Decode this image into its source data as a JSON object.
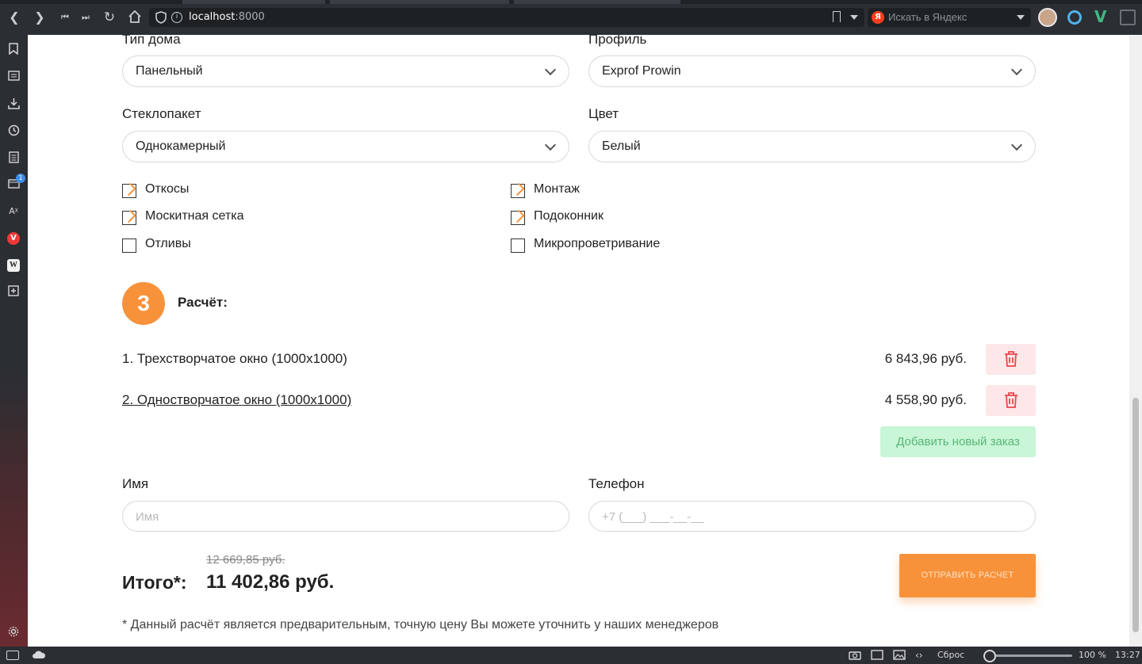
{
  "browser": {
    "url_host": "localhost",
    "url_port": ":8000",
    "search_placeholder": "Искать в Яндекс",
    "search_engine_icon": "Я",
    "sidebar_badge": "1",
    "status_reset": "Сброс",
    "status_zoom": "100 %",
    "status_time": "13:27"
  },
  "form": {
    "house_type": {
      "label": "Тип дома",
      "value": "Панельный"
    },
    "profile": {
      "label": "Профиль",
      "value": "Exprof Prowin"
    },
    "glass": {
      "label": "Стеклопакет",
      "value": "Однокамерный"
    },
    "color": {
      "label": "Цвет",
      "value": "Белый"
    },
    "options": [
      {
        "label": "Откосы",
        "checked": true
      },
      {
        "label": "Монтаж",
        "checked": true
      },
      {
        "label": "Москитная сетка",
        "checked": true
      },
      {
        "label": "Подоконник",
        "checked": true
      },
      {
        "label": "Отливы",
        "checked": false
      },
      {
        "label": "Микропроветривание",
        "checked": false
      }
    ]
  },
  "calc": {
    "step": "3",
    "title": "Расчёт:",
    "orders": [
      {
        "name": "1. Трехстворчатое окно (1000x1000)",
        "price": "6 843,96 руб."
      },
      {
        "name": "2. Одностворчатое окно (1000x1000)",
        "price": "4 558,90 руб."
      }
    ],
    "add_button": "Добавить новый заказ"
  },
  "contact": {
    "name_label": "Имя",
    "name_placeholder": "Имя",
    "phone_label": "Телефон",
    "phone_placeholder": "+7 (___) ___-__-__"
  },
  "total": {
    "label": "Итого*:",
    "old_value": "12 669,85 руб.",
    "value": "11 402,86 руб.",
    "send_button": "ОТПРАВИТЬ РАСЧЕТ",
    "footnote": "* Данный расчёт является предварительным, точную цену Вы можете уточнить у наших менеджеров"
  },
  "colors": {
    "accent": "#f7923b",
    "delete_bg": "#fde7e8",
    "delete_icon": "#e8474d",
    "add_bg": "#c9f6d6",
    "add_text": "#59b57a"
  }
}
